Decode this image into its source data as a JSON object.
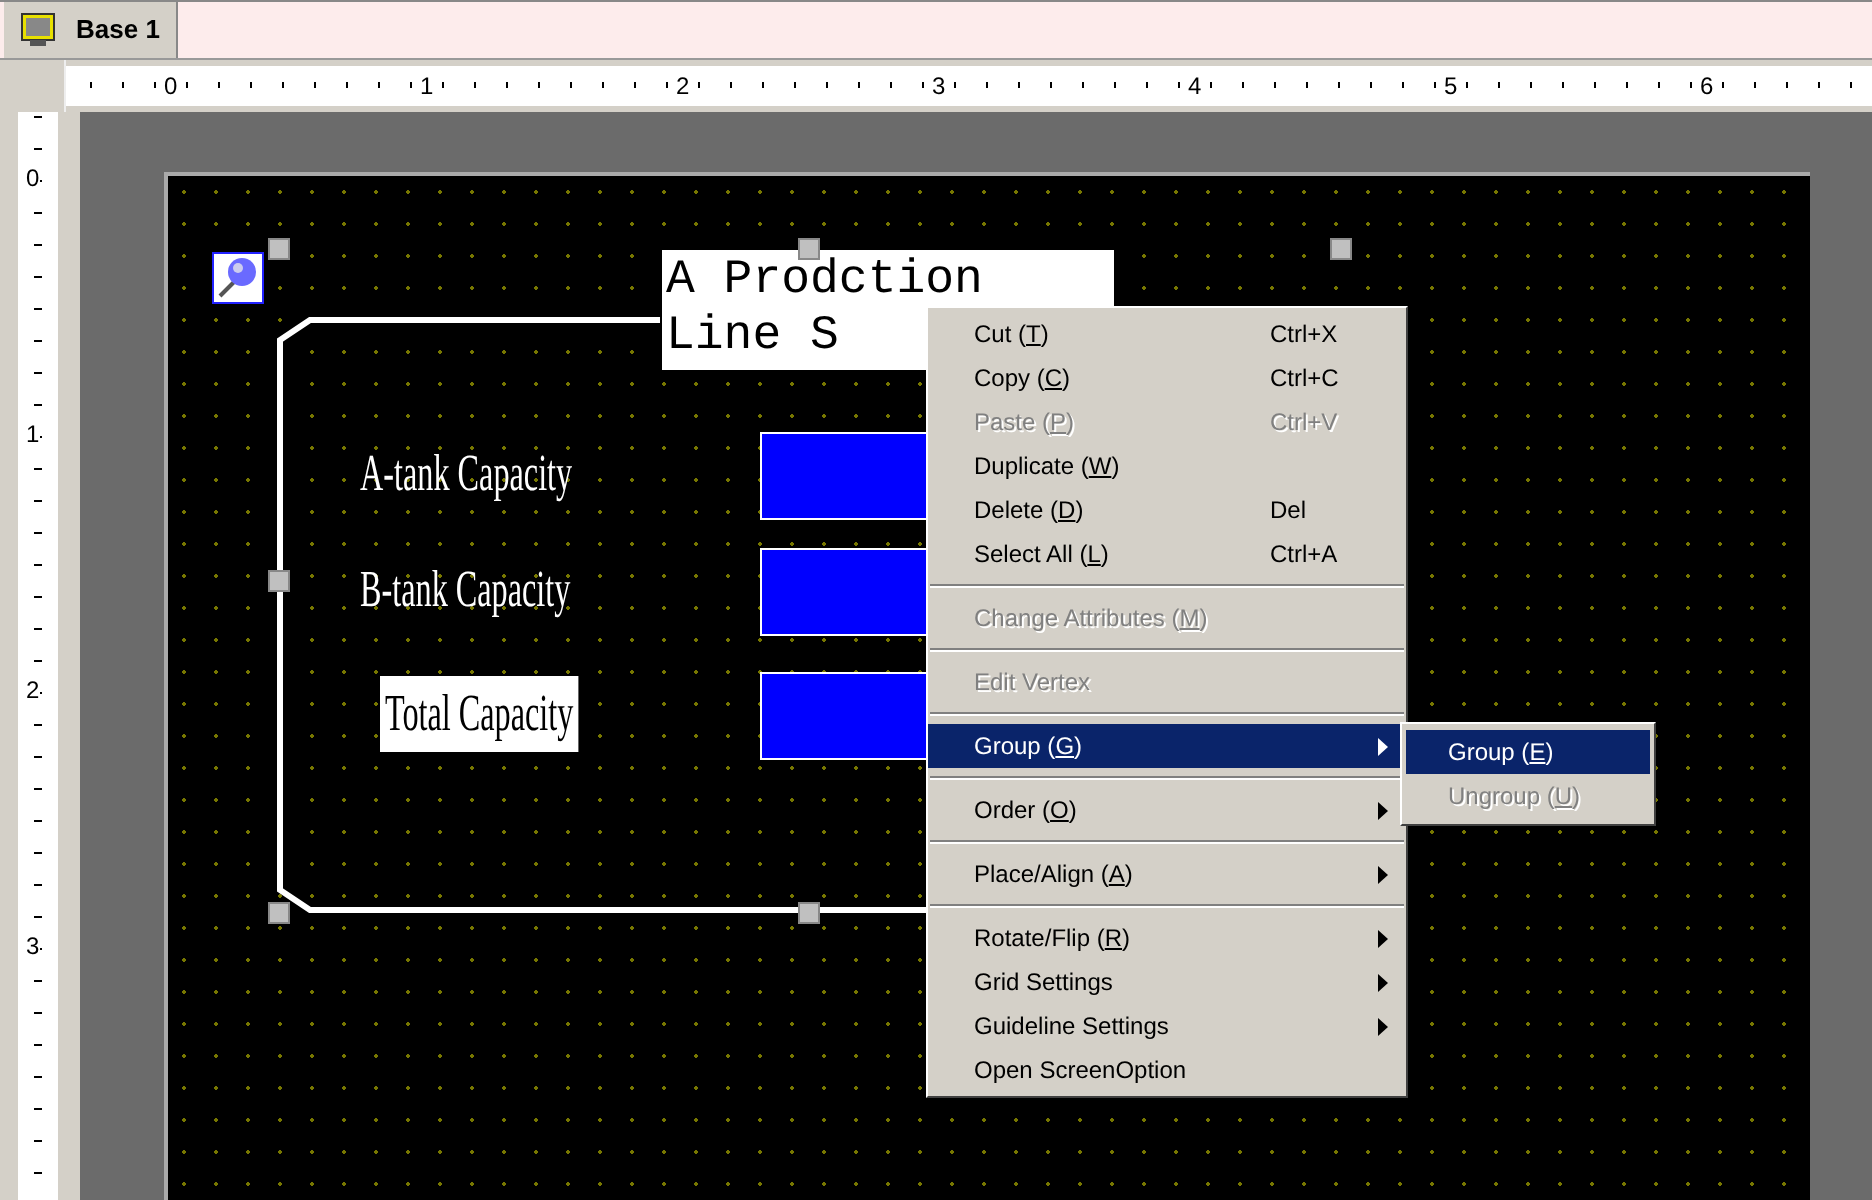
{
  "tab": {
    "label": "Base 1",
    "selected": true
  },
  "ruler": {
    "x_labels": [
      "0",
      "1",
      "2",
      "3",
      "4",
      "5",
      "6"
    ],
    "y_labels": [
      "0",
      "1",
      "2",
      "3"
    ]
  },
  "canvas": {
    "title_lines": [
      "A Prodction",
      "Line S"
    ],
    "labels": [
      {
        "text": "A-tank Capacity",
        "kind": "plain"
      },
      {
        "text": "B-tank Capacity",
        "kind": "plain"
      },
      {
        "text": "Total Capacity",
        "kind": "boxed"
      }
    ]
  },
  "context_menu": [
    {
      "kind": "item",
      "before": "Cut (",
      "mnemonic": "T",
      "after": ")",
      "shortcut": "Ctrl+X",
      "disabled": false,
      "selected": false,
      "submenu": false
    },
    {
      "kind": "item",
      "before": "Copy (",
      "mnemonic": "C",
      "after": ")",
      "shortcut": "Ctrl+C",
      "disabled": false,
      "selected": false,
      "submenu": false
    },
    {
      "kind": "item",
      "before": "Paste (",
      "mnemonic": "P",
      "after": ")",
      "shortcut": "Ctrl+V",
      "disabled": true,
      "selected": false,
      "submenu": false
    },
    {
      "kind": "item",
      "before": "Duplicate (",
      "mnemonic": "W",
      "after": ")",
      "disabled": false,
      "selected": false,
      "submenu": false
    },
    {
      "kind": "item",
      "before": "Delete (",
      "mnemonic": "D",
      "after": ")",
      "shortcut": "Del",
      "disabled": false,
      "selected": false,
      "submenu": false
    },
    {
      "kind": "item",
      "before": "Select All (",
      "mnemonic": "L",
      "after": ")",
      "shortcut": "Ctrl+A",
      "disabled": false,
      "selected": false,
      "submenu": false
    },
    {
      "kind": "separator"
    },
    {
      "kind": "item",
      "before": "Change Attributes (",
      "mnemonic": "M",
      "after": ")",
      "disabled": true,
      "selected": false,
      "submenu": false
    },
    {
      "kind": "separator"
    },
    {
      "kind": "item",
      "before": "Edit Vertex",
      "disabled": true,
      "selected": false,
      "submenu": false
    },
    {
      "kind": "separator"
    },
    {
      "kind": "item",
      "before": "Group (",
      "mnemonic": "G",
      "after": ")",
      "disabled": false,
      "selected": true,
      "submenu": true
    },
    {
      "kind": "separator"
    },
    {
      "kind": "item",
      "before": "Order (",
      "mnemonic": "O",
      "after": ")",
      "disabled": false,
      "selected": false,
      "submenu": true
    },
    {
      "kind": "separator"
    },
    {
      "kind": "item",
      "before": "Place/Align (",
      "mnemonic": "A",
      "after": ")",
      "disabled": false,
      "selected": false,
      "submenu": true
    },
    {
      "kind": "separator"
    },
    {
      "kind": "item",
      "before": "Rotate/Flip (",
      "mnemonic": "R",
      "after": ")",
      "disabled": false,
      "selected": false,
      "submenu": true
    },
    {
      "kind": "item",
      "before": "Grid Settings",
      "disabled": false,
      "selected": false,
      "submenu": true
    },
    {
      "kind": "item",
      "before": "Guideline Settings",
      "disabled": false,
      "selected": false,
      "submenu": true
    },
    {
      "kind": "item",
      "before": "Open ScreenOption",
      "disabled": false,
      "selected": false,
      "submenu": false
    }
  ],
  "submenu": [
    {
      "before": "Group (",
      "mnemonic": "E",
      "after": ")",
      "disabled": false,
      "selected": true
    },
    {
      "before": "Ungroup (",
      "mnemonic": "U",
      "after": ")",
      "disabled": true,
      "selected": false
    }
  ]
}
